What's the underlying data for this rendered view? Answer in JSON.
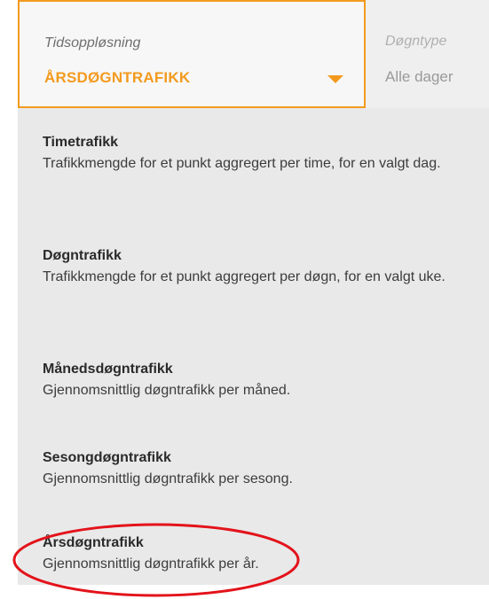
{
  "selector": {
    "time_resolution": {
      "label": "Tidsoppløsning",
      "value": "ÅRSDØGNTRAFIKK"
    },
    "day_type": {
      "label": "Døgntype",
      "value": "Alle dager"
    }
  },
  "dropdown": {
    "options": [
      {
        "title": "Timetrafikk",
        "description": "Trafikkmengde for et punkt aggregert per time, for en valgt dag."
      },
      {
        "title": "Døgntrafikk",
        "description": "Trafikkmengde for et punkt aggregert per døgn, for en valgt uke."
      },
      {
        "title": "Månedsdøgntrafikk",
        "description": "Gjennomsnittlig døgntrafikk per måned."
      },
      {
        "title": "Sesongdøgntrafikk",
        "description": "Gjennomsnittlig døgntrafikk per sesong."
      },
      {
        "title": "Årsdøgntrafikk",
        "description": "Gjennomsnittlig døgntrafikk per år."
      }
    ]
  },
  "colors": {
    "accent": "#f39a1e",
    "highlight_ring": "#e3131b",
    "dropdown_bg": "#e9e9e9"
  }
}
